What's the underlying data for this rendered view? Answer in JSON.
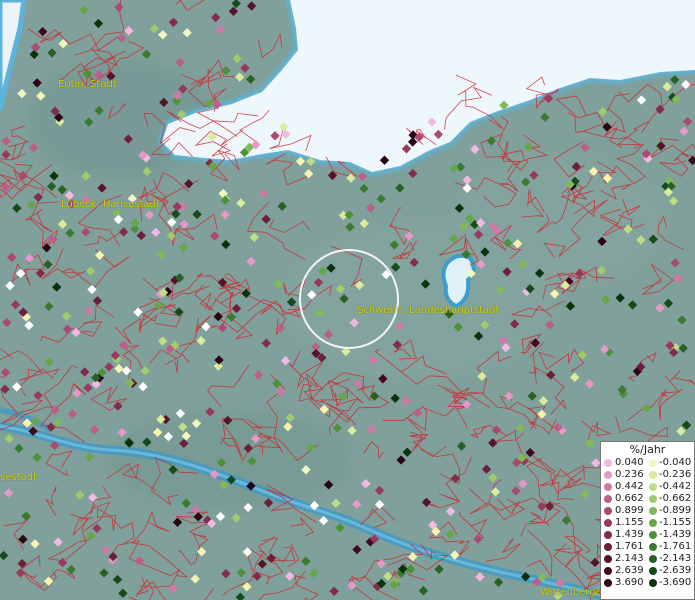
{
  "places": {
    "eutin": "Eutin, Stadt",
    "luebeck": "Lübeck, Hansestadt",
    "schwerin": "Schwerin, Landeshauptstadt",
    "hansestadt_edge": "sestadt",
    "wittenberge": "Wittenberge"
  },
  "legend": {
    "title": "%/Jahr",
    "positive": [
      "0.040",
      "0.236",
      "0.442",
      "0.662",
      "0.899",
      "1.155",
      "1.439",
      "1.761",
      "2.143",
      "2.639",
      "3.690"
    ],
    "negative": [
      "-0.040",
      "-0.236",
      "-0.442",
      "-0.662",
      "-0.899",
      "-1.155",
      "-1.439",
      "-1.761",
      "-2.143",
      "-2.639",
      "-3.690"
    ],
    "positive_colors": [
      "#f2b8e4",
      "#e39ac8",
      "#cf7aa6",
      "#bb5f88",
      "#a94a70",
      "#973a5d",
      "#812c4a",
      "#6c1f3a",
      "#56142b",
      "#400a1e",
      "#2a0412"
    ],
    "negative_colors": [
      "#f0f8c0",
      "#d8ec9c",
      "#bedd84",
      "#9fcc6c",
      "#82b95b",
      "#66a64b",
      "#4e913c",
      "#3a7a30",
      "#276224",
      "#164a18",
      "#0a330c"
    ]
  },
  "colors": {
    "land": "#7fa09b",
    "sea": "#e8f3f8",
    "water": "#2f8dba",
    "border": "#d0262f",
    "label": "#d8d400"
  }
}
